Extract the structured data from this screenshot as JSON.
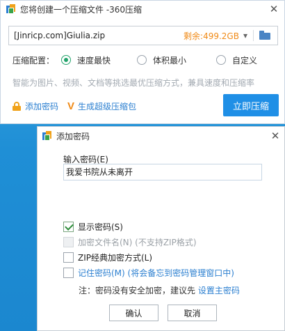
{
  "compress_window": {
    "title": "您将创建一个压缩文件 -360压缩",
    "close": "✕",
    "path": "[Jinricp.com]Giulia.zip",
    "free_space": "剩余:499.2GB",
    "dropdown": "▾",
    "options_label": "压缩配置：",
    "options": [
      {
        "label": "速度最快",
        "selected": true
      },
      {
        "label": "体积最小",
        "selected": false
      },
      {
        "label": "自定义",
        "selected": false
      }
    ],
    "hint": "智能为图片、视频、文档等挑选最优压缩方式，兼具速度和压缩率",
    "add_password_link": "添加密码",
    "super_pack_link": "生成超级压缩包",
    "super_pack_icon": "V",
    "compress_button": "立即压缩"
  },
  "password_dialog": {
    "title": "添加密码",
    "close": "✕",
    "input_label": "输入密码(E)",
    "password_value": "我爱书院从未离开",
    "checkboxes": [
      {
        "label": "显示密码(S)",
        "checked": true,
        "disabled": false
      },
      {
        "label": "加密文件名(N) (不支持ZIP格式)",
        "checked": false,
        "disabled": true
      },
      {
        "label": "ZIP经典加密方式(L)",
        "checked": false,
        "disabled": false
      },
      {
        "label": "记住密码(M) (将会备忘到密码管理窗口中)",
        "checked": false,
        "disabled": false
      }
    ],
    "note_prefix": "注：密码没有安全加密，建议先 ",
    "note_link": "设置主密码",
    "ok_button": "确认",
    "cancel_button": "取消"
  },
  "colors": {
    "accent": "#1f8fe6",
    "link": "#2b7fd0",
    "free_space": "#f08a17",
    "radio_selected": "#22a36b",
    "desktop": "#1f8fd6"
  }
}
